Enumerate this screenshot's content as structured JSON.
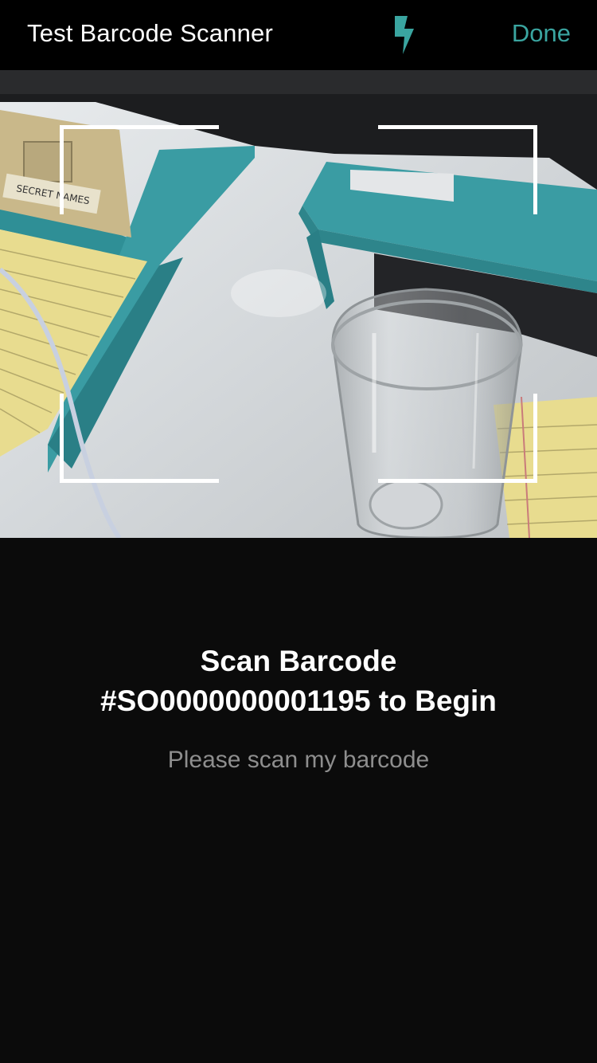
{
  "header": {
    "title": "Test Barcode Scanner",
    "flash_icon": "flash-bolt-icon",
    "done_label": "Done"
  },
  "scanner": {
    "heading_line1": "Scan Barcode",
    "heading_line2": "#SO0000000001195 to Begin",
    "subtitle": "Please scan my barcode"
  },
  "camera_preview": {
    "notebook_label": "SECRET NAMES"
  },
  "colors": {
    "accent": "#3aa5a0",
    "background": "#0b0b0b",
    "header_background": "#000000",
    "subtitle": "#8e8e8e"
  }
}
